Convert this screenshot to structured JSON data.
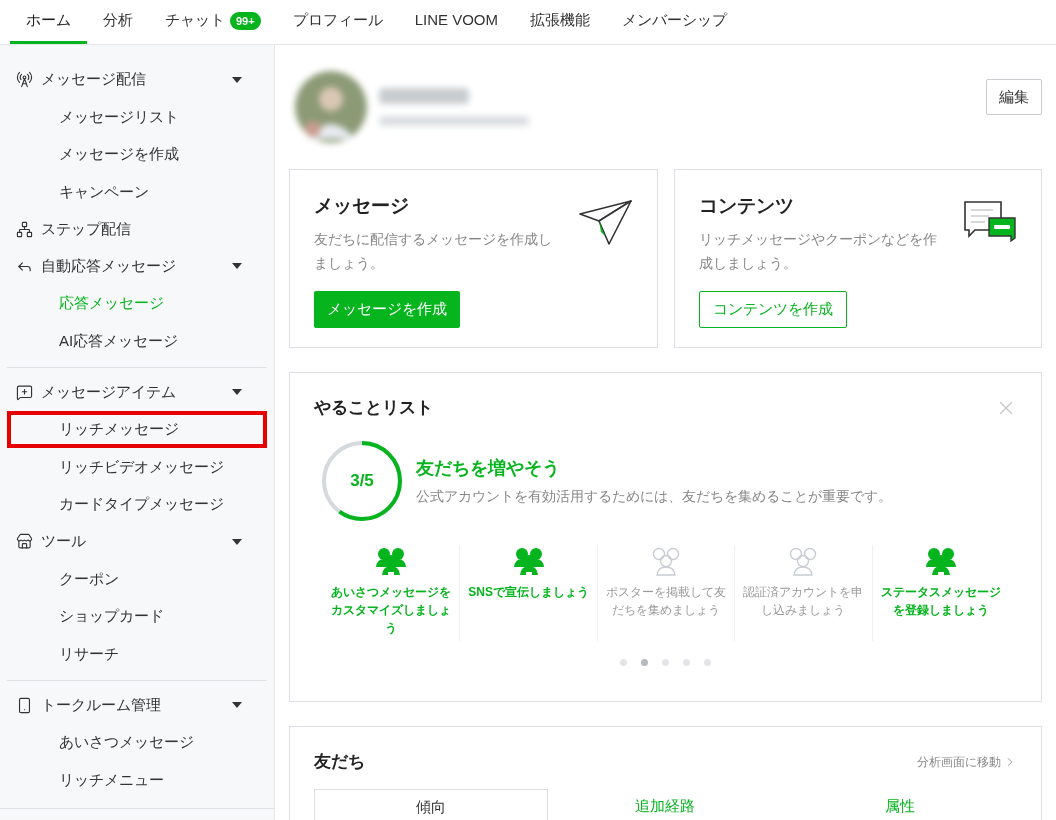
{
  "top_nav": [
    {
      "label": "ホーム",
      "selected": true
    },
    {
      "label": "分析",
      "selected": false
    },
    {
      "label": "チャット",
      "selected": false,
      "badge": "99+"
    },
    {
      "label": "プロフィール",
      "selected": false
    },
    {
      "label": "LINE VOOM",
      "selected": false
    },
    {
      "label": "拡張機能",
      "selected": false
    },
    {
      "label": "メンバーシップ",
      "selected": false
    }
  ],
  "sidebar": {
    "sections": [
      {
        "items": [
          {
            "kind": "group",
            "label": "メッセージ配信",
            "expanded": true,
            "children": [
              {
                "label": "メッセージリスト",
                "selected": false,
                "highlighted": false
              },
              {
                "label": "メッセージを作成",
                "selected": false,
                "highlighted": false
              },
              {
                "label": "キャンペーン",
                "selected": false,
                "highlighted": false
              }
            ]
          },
          {
            "kind": "link",
            "label": "ステップ配信"
          },
          {
            "kind": "group",
            "label": "自動応答メッセージ",
            "expanded": true,
            "children": [
              {
                "label": "応答メッセージ",
                "selected": true,
                "highlighted": false
              },
              {
                "label": "AI応答メッセージ",
                "selected": false,
                "highlighted": false
              }
            ]
          }
        ]
      },
      {
        "items": [
          {
            "kind": "group",
            "label": "メッセージアイテム",
            "expanded": true,
            "children": [
              {
                "label": "リッチメッセージ",
                "selected": false,
                "highlighted": true
              },
              {
                "label": "リッチビデオメッセージ",
                "selected": false,
                "highlighted": false
              },
              {
                "label": "カードタイプメッセージ",
                "selected": false,
                "highlighted": false
              }
            ]
          },
          {
            "kind": "group",
            "label": "ツール",
            "expanded": true,
            "children": [
              {
                "label": "クーポン",
                "selected": false,
                "highlighted": false
              },
              {
                "label": "ショップカード",
                "selected": false,
                "highlighted": false
              },
              {
                "label": "リサーチ",
                "selected": false,
                "highlighted": false
              }
            ]
          }
        ]
      },
      {
        "items": [
          {
            "kind": "group",
            "label": "トークルーム管理",
            "expanded": true,
            "children": [
              {
                "label": "あいさつメッセージ",
                "selected": false,
                "highlighted": false
              },
              {
                "label": "リッチメニュー",
                "selected": false,
                "highlighted": false
              }
            ]
          }
        ]
      }
    ]
  },
  "profile": {
    "edit_button": "編集"
  },
  "cards": [
    {
      "title": "メッセージ",
      "description": "友だちに配信するメッセージを作成しましょう。",
      "button": "メッセージを作成"
    },
    {
      "title": "コンテンツ",
      "description": "リッチメッセージやクーポンなどを作成しましょう。",
      "button": "コンテンツを作成"
    }
  ],
  "todo": {
    "title": "やることリスト",
    "progress": {
      "reading": "3/5",
      "level": 0.6
    },
    "heading": "友だちを増やそう",
    "description": "公式アカウントを有効活用するためには、友だちを集めることが重要です。",
    "tasks": [
      {
        "label": "あいさつメッセージをカスタマイズしましょう",
        "done": true
      },
      {
        "label": "SNSで宣伝しましょう",
        "done": true
      },
      {
        "label": "ポスターを掲載して友だちを集めましょう",
        "done": false
      },
      {
        "label": "認証済アカウントを申し込みましょう",
        "done": false
      },
      {
        "label": "ステータスメッセージを登録しましょう",
        "done": true
      }
    ],
    "pages": [
      {
        "selected": false
      },
      {
        "selected": true
      },
      {
        "selected": false
      },
      {
        "selected": false
      },
      {
        "selected": false
      }
    ]
  },
  "friends": {
    "title": "友だち",
    "link": "分析画面に移動",
    "tabs": [
      {
        "label": "傾向",
        "selected": true
      },
      {
        "label": "追加経路",
        "selected": false
      },
      {
        "label": "属性",
        "selected": false
      }
    ]
  }
}
